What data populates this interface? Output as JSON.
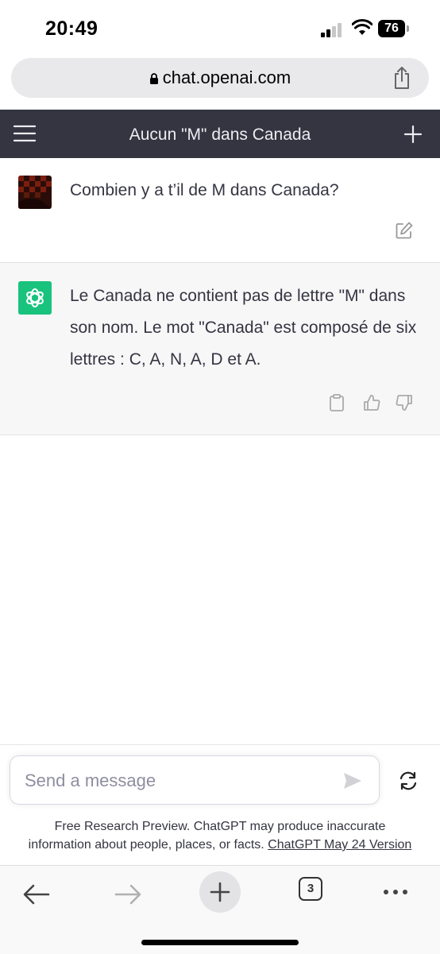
{
  "status_bar": {
    "time": "20:49",
    "battery": "76"
  },
  "browser": {
    "url": "chat.openai.com",
    "tabs_count": "3"
  },
  "chat": {
    "title": "Aucun \"M\" dans Canada",
    "user_message": "Combien y a t’il de M dans Canada?",
    "assistant_message": "Le Canada ne contient pas de lettre \"M\" dans son nom. Le mot \"Canada\" est composé de six lettres : C, A, N, A, D et A."
  },
  "composer": {
    "placeholder": "Send a message"
  },
  "disclaimer": {
    "line1": "Free Research Preview. ChatGPT may produce inaccurate",
    "line2": "information about people, places, or facts.",
    "link": "ChatGPT May 24 Version"
  },
  "colors": {
    "header_bg": "#343541",
    "assistant_bg": "#f7f7f8",
    "brand_green": "#19c37d"
  },
  "icons": [
    "lock-icon",
    "share-icon",
    "menu-icon",
    "plus-icon",
    "edit-icon",
    "openai-logo-icon",
    "clipboard-icon",
    "thumbs-up-icon",
    "thumbs-down-icon",
    "send-icon",
    "regenerate-icon",
    "back-arrow-icon",
    "forward-arrow-icon",
    "new-tab-icon",
    "more-icon"
  ]
}
